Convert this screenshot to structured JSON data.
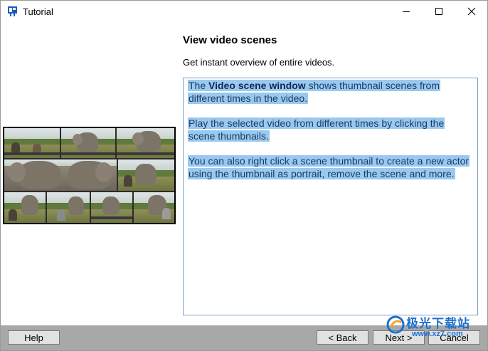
{
  "window": {
    "title": "Tutorial",
    "icons": {
      "app": "app-logo-icon",
      "minimize": "minimize-icon",
      "maximize": "maximize-icon",
      "close": "close-icon"
    }
  },
  "content": {
    "heading": "View video scenes",
    "subtitle": "Get instant overview of entire videos.",
    "paragraphs": {
      "p1_before": "The ",
      "p1_bold": "Video scene window",
      "p1_after": " shows thumbnail scenes from different times in the video.",
      "p2": "Play the selected video from different times by clicking the scene thumbnails.",
      "p3": "You can also right click a scene thumbnail to create a new actor using the thumbnail as portrait, remove the scene and more."
    },
    "selection_color": "#99c9ef"
  },
  "buttons": {
    "help": "Help",
    "back": "< Back",
    "next": "Next >",
    "cancel": "Cancel"
  },
  "watermark": {
    "text": "极光下载站",
    "url": "www.xz7.com"
  },
  "colors": {
    "bottom_bar": "#a8a8a8",
    "textbox_border": "#7a9cc6",
    "watermark": "#1d6fd1"
  }
}
